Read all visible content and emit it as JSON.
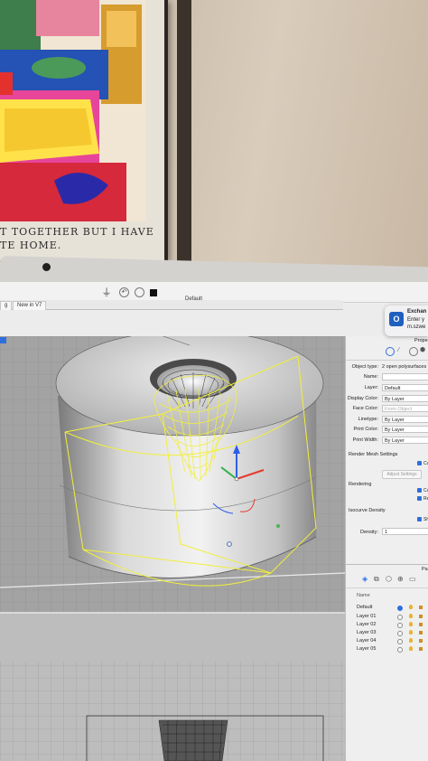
{
  "poster": {
    "line1": "T TOGETHER BUT I HAVE",
    "line2": "TE HOME."
  },
  "toolbar": {
    "layer_value": "Default"
  },
  "tabs": [
    {
      "label": "g"
    },
    {
      "label": "New in V7"
    }
  ],
  "notification": {
    "title": "Exchan",
    "line1": "Enter y",
    "line2": "m.szwe"
  },
  "properties": {
    "header": "Prope",
    "fields": [
      {
        "label": "Object type:",
        "value": "2 open polysurfaces"
      },
      {
        "label": "Name:",
        "value": ""
      },
      {
        "label": "Layer:",
        "value": "Default"
      },
      {
        "label": "Display Color:",
        "value": "By Layer"
      },
      {
        "label": "Face Color:",
        "value": "From Object"
      },
      {
        "label": "Linetype:",
        "value": "By Layer"
      },
      {
        "label": "Print Color:",
        "value": "By Layer"
      },
      {
        "label": "Print Width:",
        "value": "By Layer"
      }
    ],
    "render_mesh_label": "Render Mesh Settings",
    "render_mesh_check": "Cu",
    "adjust_button": "Adjust Settings",
    "rendering_label": "Rendering",
    "rendering_checks": [
      "Ca",
      "Re"
    ],
    "isocurve_label": "Isocurve Density",
    "isocurve_check": "Sh",
    "density_label": "Density:",
    "density_value": "1"
  },
  "layers": {
    "header": "Pa",
    "column_name": "Name",
    "items": [
      "Default",
      "Layer 01",
      "Layer 02",
      "Layer 03",
      "Layer 04",
      "Layer 05"
    ]
  },
  "colors": {
    "selection": "#f2ef3a",
    "viewport_bg": "#8f8f8f",
    "accent": "#2f6fdc"
  }
}
